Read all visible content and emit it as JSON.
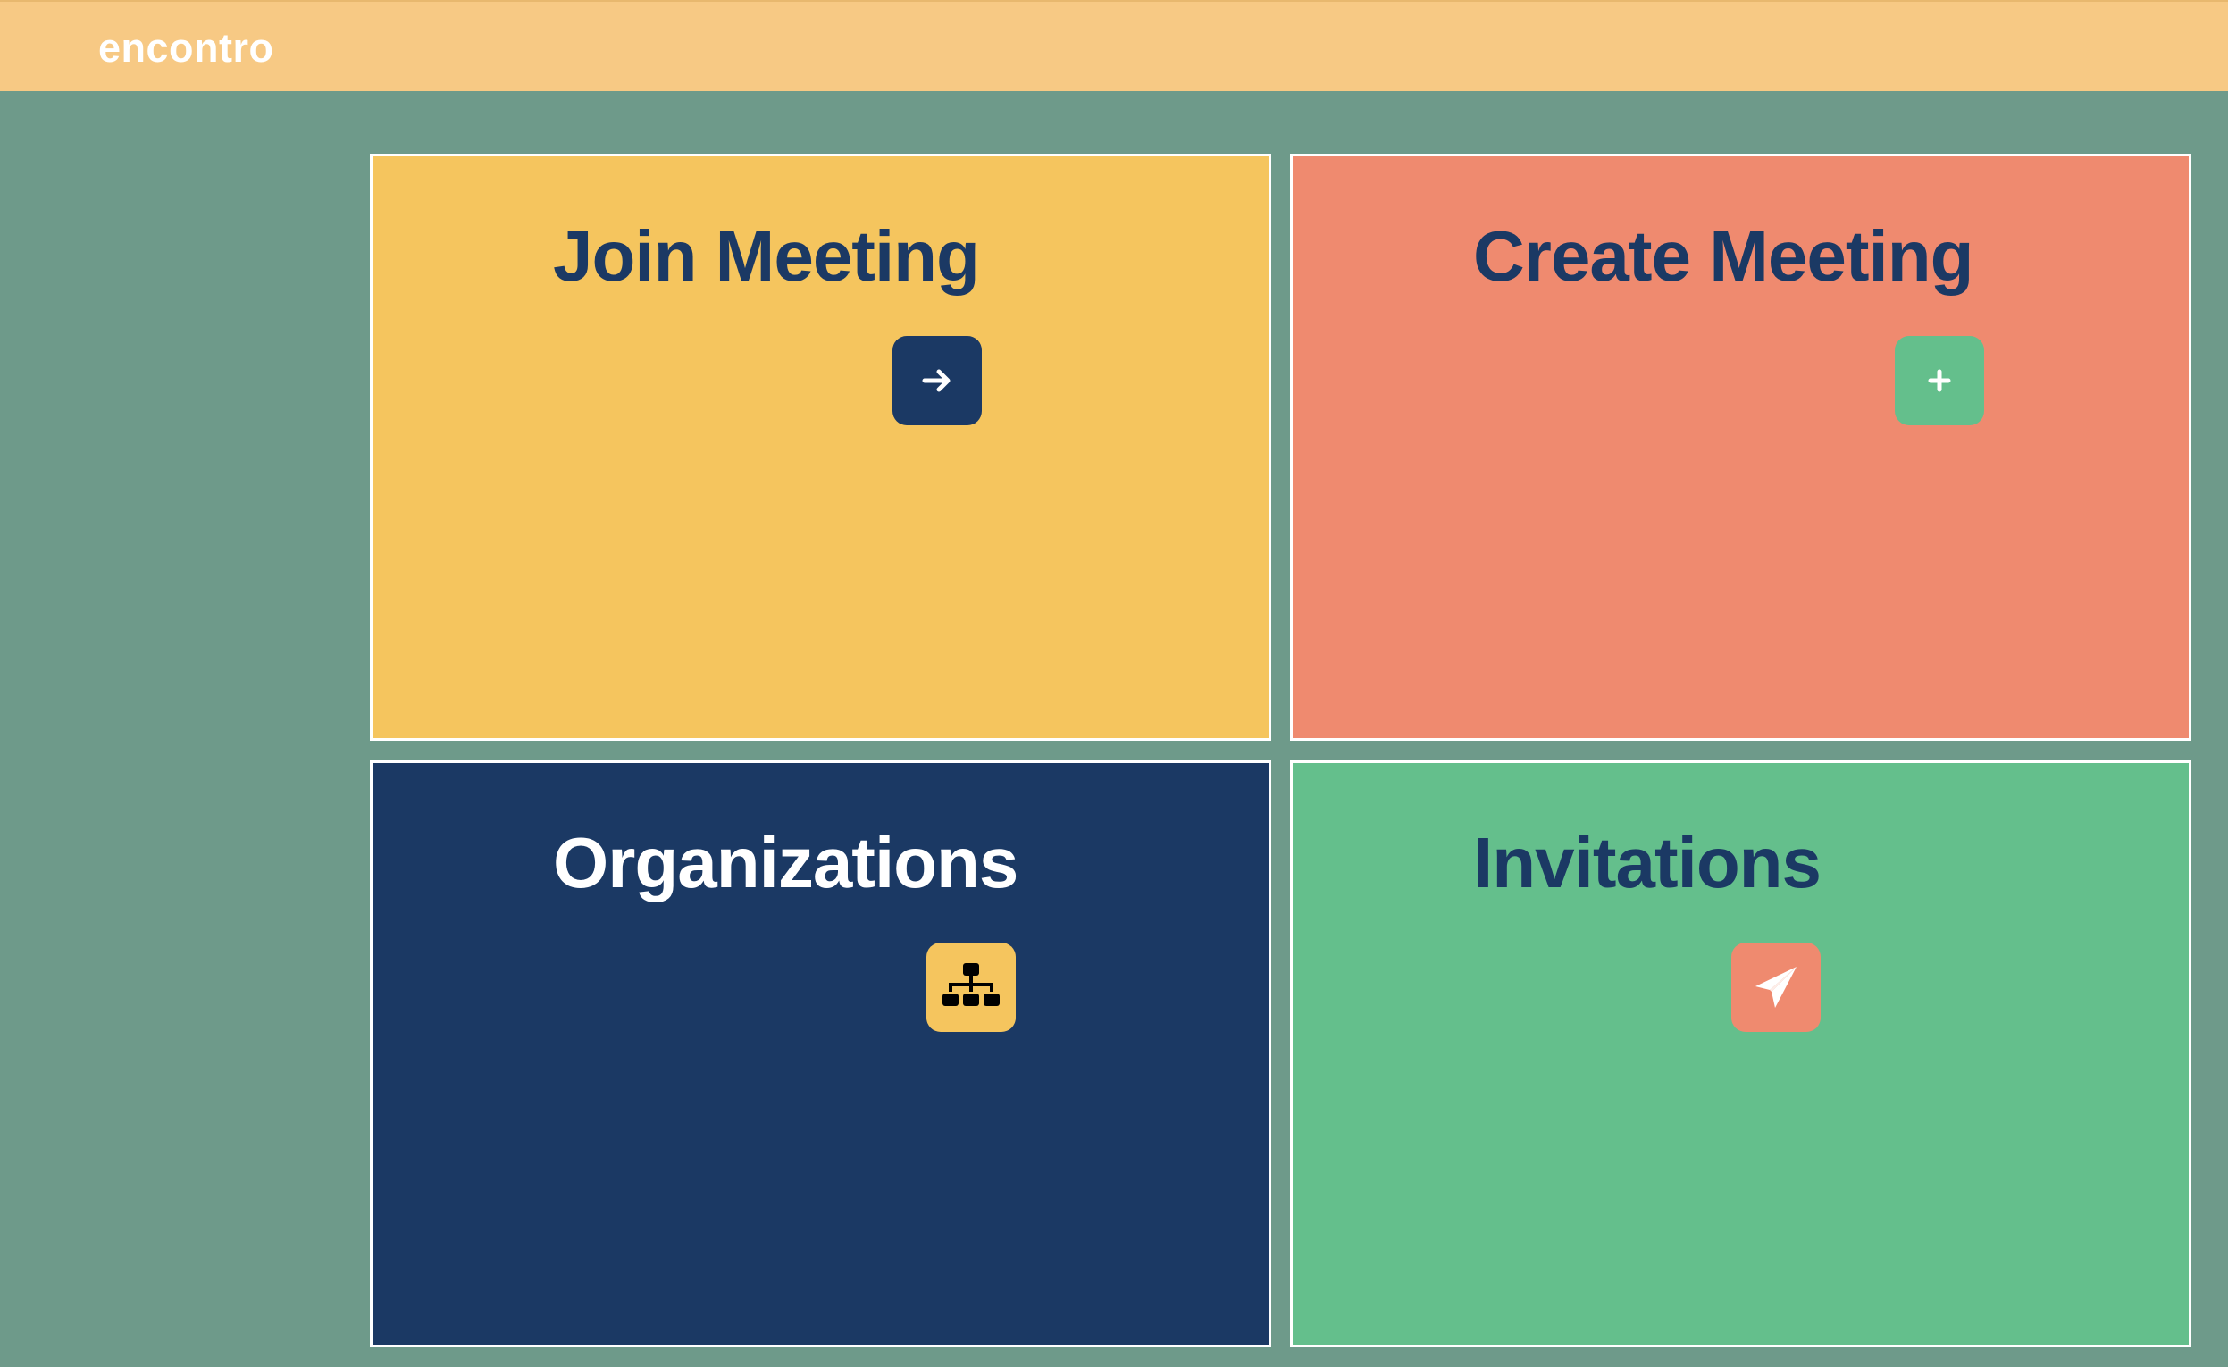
{
  "app": {
    "brand": "encontro"
  },
  "tiles": [
    {
      "title": "Join Meeting",
      "icon": "arrow-right-icon",
      "tile_color": "#f5c55e",
      "title_color": "#1b3964",
      "button_color": "#1b3964",
      "icon_color": "#ffffff"
    },
    {
      "title": "Create Meeting",
      "icon": "plus-icon",
      "tile_color": "#ef8a6f",
      "title_color": "#1b3964",
      "button_color": "#64bf8c",
      "icon_color": "#ffffff"
    },
    {
      "title": "Organizations",
      "icon": "org-chart-icon",
      "tile_color": "#1b3964",
      "title_color": "#ffffff",
      "button_color": "#f5c55e",
      "icon_color": "#000000"
    },
    {
      "title": "Invitations",
      "icon": "paper-plane-icon",
      "tile_color": "#64bf8c",
      "title_color": "#1b3964",
      "button_color": "#ef8a6f",
      "icon_color": "#ffffff"
    }
  ],
  "colors": {
    "background": "#6e9a8a",
    "topbar": "#f7c984",
    "tile_border": "#ffffff"
  }
}
